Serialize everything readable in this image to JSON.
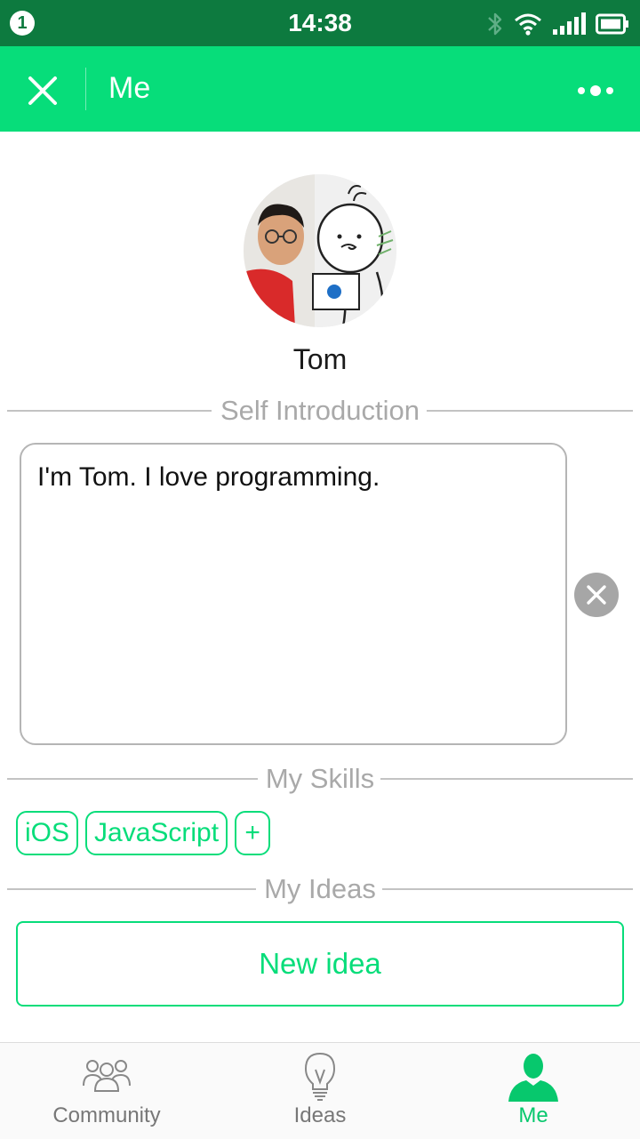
{
  "status_bar": {
    "notification_count": "1",
    "time": "14:38"
  },
  "app_bar": {
    "title": "Me",
    "close_icon": "close-icon",
    "more_icon": "more-dots-icon"
  },
  "profile": {
    "name": "Tom"
  },
  "sections": {
    "self_intro": "Self Introduction",
    "skills": "My Skills",
    "ideas": "My Ideas"
  },
  "intro": {
    "text": "I'm Tom. I love programming."
  },
  "skills": [
    {
      "label": "iOS"
    },
    {
      "label": "JavaScript"
    }
  ],
  "add_skill": "+",
  "ideas": {
    "new_button": "New idea"
  },
  "tabs": [
    {
      "label": "Community",
      "icon": "community-icon",
      "active": false
    },
    {
      "label": "Ideas",
      "icon": "lightbulb-icon",
      "active": false
    },
    {
      "label": "Me",
      "icon": "person-icon",
      "active": true
    }
  ],
  "colors": {
    "accent": "#07dd7a",
    "status_bar": "#0d7a3f",
    "active_tab": "#07c86d",
    "divider": "#c3c3c3"
  }
}
